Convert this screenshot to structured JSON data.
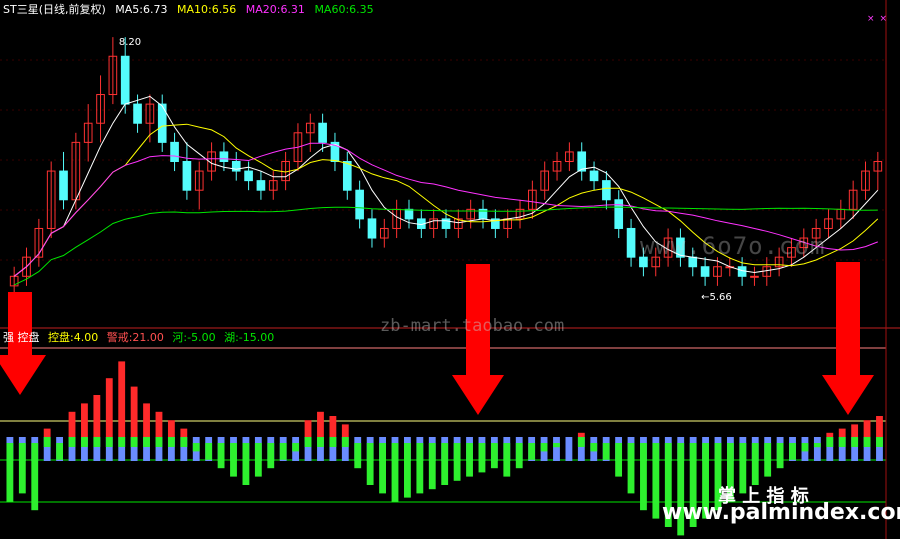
{
  "header": {
    "stock": "ST三星(日线,前复权)",
    "ma5": "MA5:6.73",
    "ma10": "MA10:6.56",
    "ma20": "MA20:6.31",
    "ma60": "MA60:6.35",
    "close_icons": "× ×"
  },
  "annotations": {
    "high": "8.20",
    "low": "←5.66"
  },
  "indicator": {
    "name": "强  控盘",
    "kongpan": "控盘:4.00",
    "jingjie": "警戒:21.00",
    "he": "河:-5.00",
    "hu": "湖:-15.00"
  },
  "watermarks": {
    "site1": "www.6o7o.com",
    "site2": "zb-mart.taobao.com",
    "title": "掌 上 指 标",
    "site3": "www.palmindex.com"
  },
  "colors": {
    "up": "#ff3232",
    "down": "#54fcfc",
    "ma5": "#ffffff",
    "ma10": "#ffff00",
    "ma20": "#ff32ff",
    "ma60": "#00e600",
    "bar_red": "#ff2a2a",
    "bar_blue": "#6a8cff",
    "bar_green": "#2ef02e",
    "arrow": "#ff0000"
  },
  "chart_data": {
    "type": "candlestick",
    "y_range": [
      5.4,
      8.4
    ],
    "candles": [
      [
        5.6,
        5.8,
        5.5,
        5.7
      ],
      [
        5.7,
        6.0,
        5.6,
        5.9
      ],
      [
        5.9,
        6.3,
        5.8,
        6.2
      ],
      [
        6.2,
        6.9,
        6.1,
        6.8
      ],
      [
        6.8,
        7.0,
        6.4,
        6.5
      ],
      [
        6.5,
        7.2,
        6.4,
        7.1
      ],
      [
        7.1,
        7.5,
        6.9,
        7.3
      ],
      [
        7.3,
        7.8,
        7.1,
        7.6
      ],
      [
        7.6,
        8.2,
        7.5,
        8.0
      ],
      [
        8.0,
        8.2,
        7.4,
        7.5
      ],
      [
        7.5,
        7.6,
        7.2,
        7.3
      ],
      [
        7.3,
        7.6,
        7.1,
        7.5
      ],
      [
        7.5,
        7.6,
        7.0,
        7.1
      ],
      [
        7.1,
        7.2,
        6.8,
        6.9
      ],
      [
        6.9,
        7.1,
        6.5,
        6.6
      ],
      [
        6.6,
        6.9,
        6.4,
        6.8
      ],
      [
        6.8,
        7.1,
        6.7,
        7.0
      ],
      [
        7.0,
        7.1,
        6.8,
        6.9
      ],
      [
        6.9,
        7.0,
        6.7,
        6.8
      ],
      [
        6.8,
        6.9,
        6.6,
        6.7
      ],
      [
        6.7,
        6.8,
        6.5,
        6.6
      ],
      [
        6.6,
        6.8,
        6.5,
        6.7
      ],
      [
        6.7,
        7.0,
        6.6,
        6.9
      ],
      [
        6.9,
        7.3,
        6.8,
        7.2
      ],
      [
        7.2,
        7.4,
        7.0,
        7.3
      ],
      [
        7.3,
        7.4,
        7.0,
        7.1
      ],
      [
        7.1,
        7.2,
        6.8,
        6.9
      ],
      [
        6.9,
        7.0,
        6.5,
        6.6
      ],
      [
        6.6,
        6.7,
        6.2,
        6.3
      ],
      [
        6.3,
        6.4,
        6.0,
        6.1
      ],
      [
        6.1,
        6.3,
        6.0,
        6.2
      ],
      [
        6.2,
        6.5,
        6.1,
        6.4
      ],
      [
        6.4,
        6.5,
        6.2,
        6.3
      ],
      [
        6.3,
        6.4,
        6.1,
        6.2
      ],
      [
        6.2,
        6.4,
        6.1,
        6.3
      ],
      [
        6.3,
        6.4,
        6.1,
        6.2
      ],
      [
        6.2,
        6.4,
        6.1,
        6.3
      ],
      [
        6.3,
        6.5,
        6.2,
        6.4
      ],
      [
        6.4,
        6.5,
        6.2,
        6.3
      ],
      [
        6.3,
        6.4,
        6.1,
        6.2
      ],
      [
        6.2,
        6.4,
        6.1,
        6.3
      ],
      [
        6.3,
        6.5,
        6.2,
        6.4
      ],
      [
        6.4,
        6.7,
        6.3,
        6.6
      ],
      [
        6.6,
        6.9,
        6.5,
        6.8
      ],
      [
        6.8,
        7.0,
        6.7,
        6.9
      ],
      [
        6.9,
        7.1,
        6.8,
        7.0
      ],
      [
        7.0,
        7.1,
        6.7,
        6.8
      ],
      [
        6.8,
        6.9,
        6.6,
        6.7
      ],
      [
        6.7,
        6.8,
        6.4,
        6.5
      ],
      [
        6.5,
        6.6,
        6.1,
        6.2
      ],
      [
        6.2,
        6.3,
        5.8,
        5.9
      ],
      [
        5.9,
        6.0,
        5.7,
        5.8
      ],
      [
        5.8,
        6.0,
        5.7,
        5.9
      ],
      [
        5.9,
        6.2,
        5.8,
        6.1
      ],
      [
        6.1,
        6.2,
        5.8,
        5.9
      ],
      [
        5.9,
        6.0,
        5.7,
        5.8
      ],
      [
        5.8,
        5.9,
        5.6,
        5.7
      ],
      [
        5.7,
        5.9,
        5.6,
        5.8
      ],
      [
        5.8,
        5.9,
        5.7,
        5.8
      ],
      [
        5.8,
        5.9,
        5.6,
        5.7
      ],
      [
        5.7,
        5.8,
        5.6,
        5.7
      ],
      [
        5.7,
        5.9,
        5.6,
        5.8
      ],
      [
        5.8,
        6.0,
        5.7,
        5.9
      ],
      [
        5.9,
        6.1,
        5.8,
        6.0
      ],
      [
        6.0,
        6.2,
        5.9,
        6.1
      ],
      [
        6.1,
        6.3,
        6.0,
        6.2
      ],
      [
        6.2,
        6.4,
        6.1,
        6.3
      ],
      [
        6.3,
        6.5,
        6.2,
        6.4
      ],
      [
        6.4,
        6.7,
        6.3,
        6.6
      ],
      [
        6.6,
        6.9,
        6.5,
        6.8
      ],
      [
        6.8,
        7.0,
        6.6,
        6.9
      ]
    ],
    "indicator_values": [
      -14,
      -12,
      -16,
      2,
      -4,
      6,
      8,
      10,
      14,
      18,
      12,
      8,
      6,
      4,
      2,
      -2,
      -4,
      -6,
      -8,
      -10,
      -8,
      -6,
      -4,
      -2,
      4,
      6,
      5,
      3,
      -6,
      -10,
      -12,
      -14,
      -13,
      -12,
      -11,
      -10,
      -9,
      -8,
      -7,
      -6,
      -8,
      -6,
      -4,
      -2,
      -1,
      0,
      1,
      -2,
      -4,
      -8,
      -12,
      -16,
      -18,
      -20,
      -22,
      -20,
      -18,
      -16,
      -14,
      -12,
      -10,
      -8,
      -6,
      -4,
      -2,
      -1,
      1,
      2,
      3,
      4,
      5
    ]
  }
}
